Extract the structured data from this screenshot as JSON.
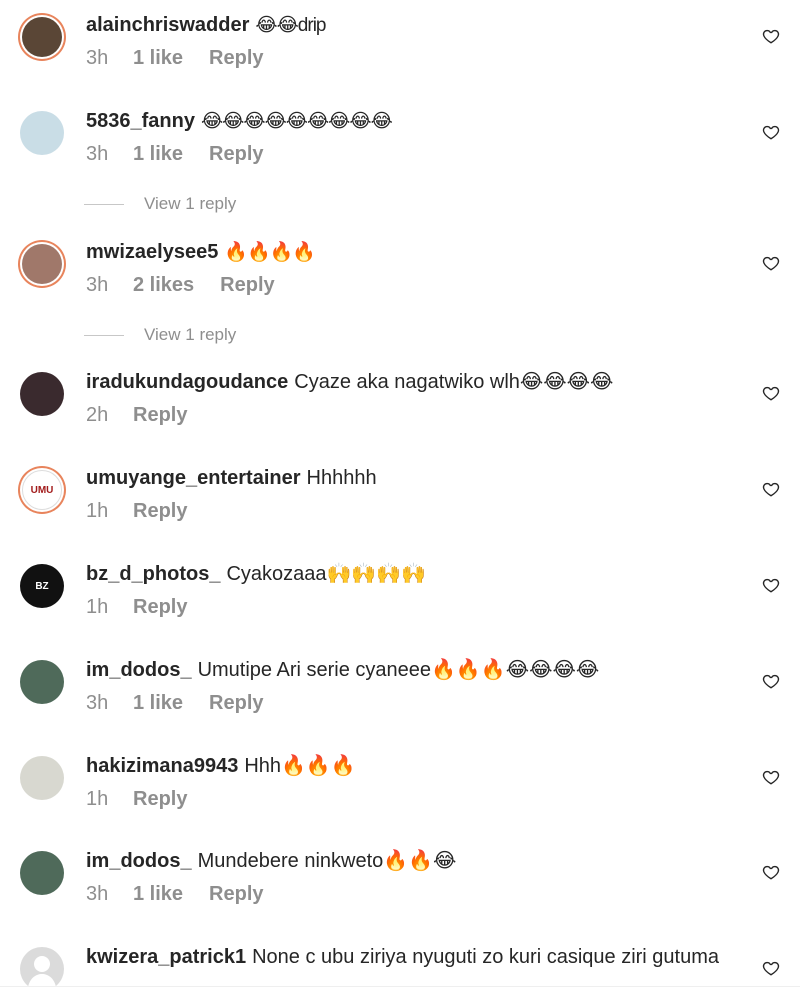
{
  "comments": [
    {
      "username": "alainchriswadder",
      "text": "😂😂drip",
      "time": "3h",
      "likes": "1 like",
      "reply": "Reply"
    },
    {
      "username": "5836_fanny",
      "text": "😂😂😂😂😂😂😂😂😂",
      "time": "3h",
      "likes": "1 like",
      "reply": "Reply"
    },
    {
      "username": "mwizaelysee5",
      "text": "🔥🔥🔥🔥",
      "time": "3h",
      "likes": "2 likes",
      "reply": "Reply"
    },
    {
      "username": "iradukundagoudance",
      "text": "Cyaze aka nagatwiko wlh😂😂😂😂",
      "time": "2h",
      "likes": "",
      "reply": "Reply"
    },
    {
      "username": "umuyange_entertainer",
      "text": "Hhhhhh",
      "time": "1h",
      "likes": "",
      "reply": "Reply"
    },
    {
      "username": "bz_d_photos_",
      "text": "Cyakozaaa🙌🙌🙌🙌",
      "time": "1h",
      "likes": "",
      "reply": "Reply"
    },
    {
      "username": "im_dodos_",
      "text": "Umutipe Ari serie cyaneee🔥🔥🔥😂😂😂😂",
      "time": "3h",
      "likes": "1 like",
      "reply": "Reply"
    },
    {
      "username": "hakizimana9943",
      "text": "Hhh🔥🔥🔥",
      "time": "1h",
      "likes": "",
      "reply": "Reply"
    },
    {
      "username": "im_dodos_",
      "text": "Mundebere ninkweto🔥🔥😂",
      "time": "3h",
      "likes": "1 like",
      "reply": "Reply"
    },
    {
      "username": "kwizera_patrick1",
      "text": "None c ubu ziriya nyuguti zo kuri casique ziri gutuma",
      "time": "",
      "likes": "",
      "reply": ""
    }
  ],
  "view_replies": [
    "View 1 reply",
    "View 1 reply"
  ],
  "icons": {
    "heart": "heart-outline-icon"
  },
  "colors": {
    "meta": "#8e8e8e",
    "text": "#262626",
    "ring": "#e8845c"
  }
}
